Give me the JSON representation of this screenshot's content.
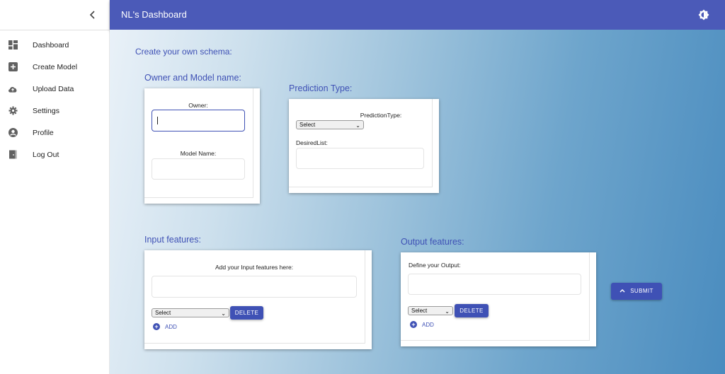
{
  "sidebar": {
    "collapse_icon": "chevron-left-icon",
    "items": [
      {
        "label": "Dashboard",
        "icon": "dashboard-icon"
      },
      {
        "label": "Create Model",
        "icon": "add-box-icon"
      },
      {
        "label": "Upload Data",
        "icon": "cloud-upload-icon"
      },
      {
        "label": "Settings",
        "icon": "gear-icon"
      },
      {
        "label": "Profile",
        "icon": "account-circle-icon"
      },
      {
        "label": "Log Out",
        "icon": "exit-door-icon"
      }
    ]
  },
  "appbar": {
    "title": "NL's Dashboard",
    "theme_icon": "brightness-icon",
    "color": "#4b5ab8"
  },
  "main": {
    "schema_title": "Create your own schema:",
    "owner_section": {
      "title": "Owner and Model name:",
      "owner_label": "Owner:",
      "owner_value": "",
      "model_name_label": "Model Name:",
      "model_name_value": ""
    },
    "prediction_section": {
      "title": "Prediction Type:",
      "type_label": "PredictionType:",
      "type_selected": "Select",
      "desired_list_label": "DesiredList:",
      "desired_list_value": ""
    },
    "input_section": {
      "title": "Input features:",
      "prompt": "Add your Input features here:",
      "input_value": "",
      "select_value": "Select",
      "delete_label": "DELETE",
      "add_label": "ADD"
    },
    "output_section": {
      "title": "Output features:",
      "prompt": "Define your Output:",
      "input_value": "",
      "select_value": "Select",
      "delete_label": "DELETE",
      "add_label": "ADD"
    },
    "submit_label": "SUBMIT"
  },
  "colors": {
    "accent": "#3f51b5"
  }
}
